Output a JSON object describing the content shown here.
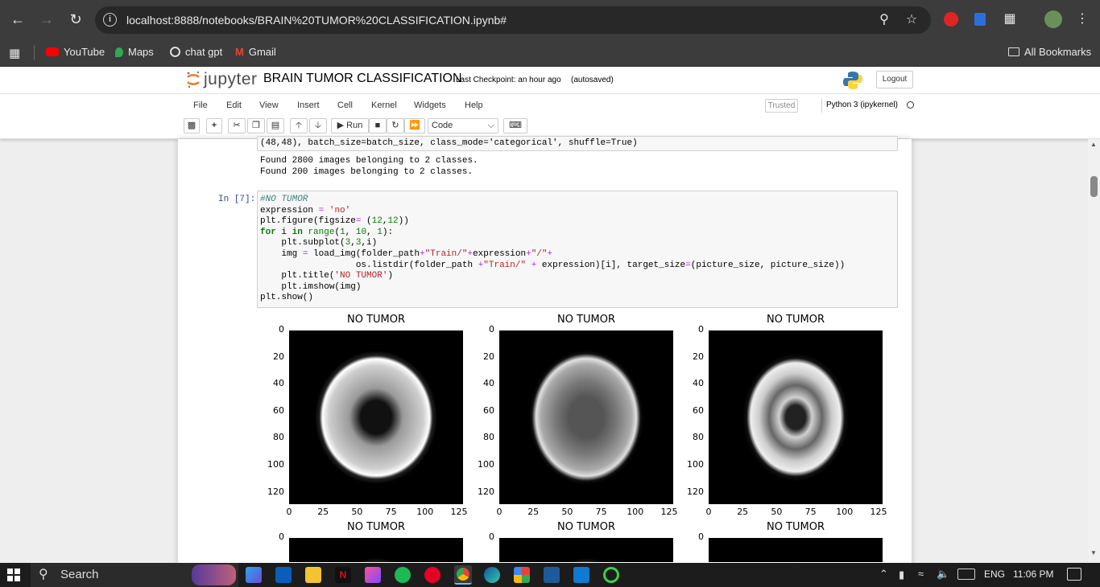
{
  "browser": {
    "url": "localhost:8888/notebooks/BRAIN%20TUMOR%20CLASSIFICATION.ipynb#",
    "bookmarks": [
      "YouTube",
      "Maps",
      "chat gpt",
      "Gmail"
    ],
    "all_bookmarks": "All Bookmarks"
  },
  "jupyter": {
    "logo_text": "jupyter",
    "notebook_title": "BRAIN TUMOR CLASSIFICATION",
    "checkpoint": "Last Checkpoint: an hour ago",
    "autosaved": "(autosaved)",
    "logout": "Logout",
    "menu": [
      "File",
      "Edit",
      "View",
      "Insert",
      "Cell",
      "Kernel",
      "Widgets",
      "Help"
    ],
    "trusted": "Trusted",
    "kernel": "Python 3 (ipykernel)",
    "run_label": "Run",
    "cell_type": "Code"
  },
  "cells": {
    "prev_tail": "(48,48), batch_size=batch_size, class_mode='categorical', shuffle=True)",
    "prev_output": [
      "Found 2800 images belonging to 2 classes.",
      "Found 200 images belonging to 2 classes."
    ],
    "prompt": "In [7]:",
    "code_lines": [
      "#NO TUMOR",
      "expression = 'no'",
      "plt.figure(figsize= (12,12))",
      "for i in range(1, 10, 1):",
      "    plt.subplot(3,3,i)",
      "    img = load_img(folder_path+\"Train/\"+expression+\"/\"+",
      "                  os.listdir(folder_path +\"Train/\" + expression)[i], target_size=(picture_size, picture_size))",
      "    plt.title('NO TUMOR')",
      "    plt.imshow(img)",
      "plt.show()"
    ]
  },
  "plot": {
    "subplot_title": "NO TUMOR",
    "y_ticks": [
      "0",
      "20",
      "40",
      "60",
      "80",
      "100",
      "120"
    ],
    "x_ticks": [
      "0",
      "25",
      "50",
      "75",
      "100",
      "125"
    ]
  },
  "taskbar": {
    "search": "Search",
    "lang": "ENG",
    "time": "11:06 PM"
  }
}
